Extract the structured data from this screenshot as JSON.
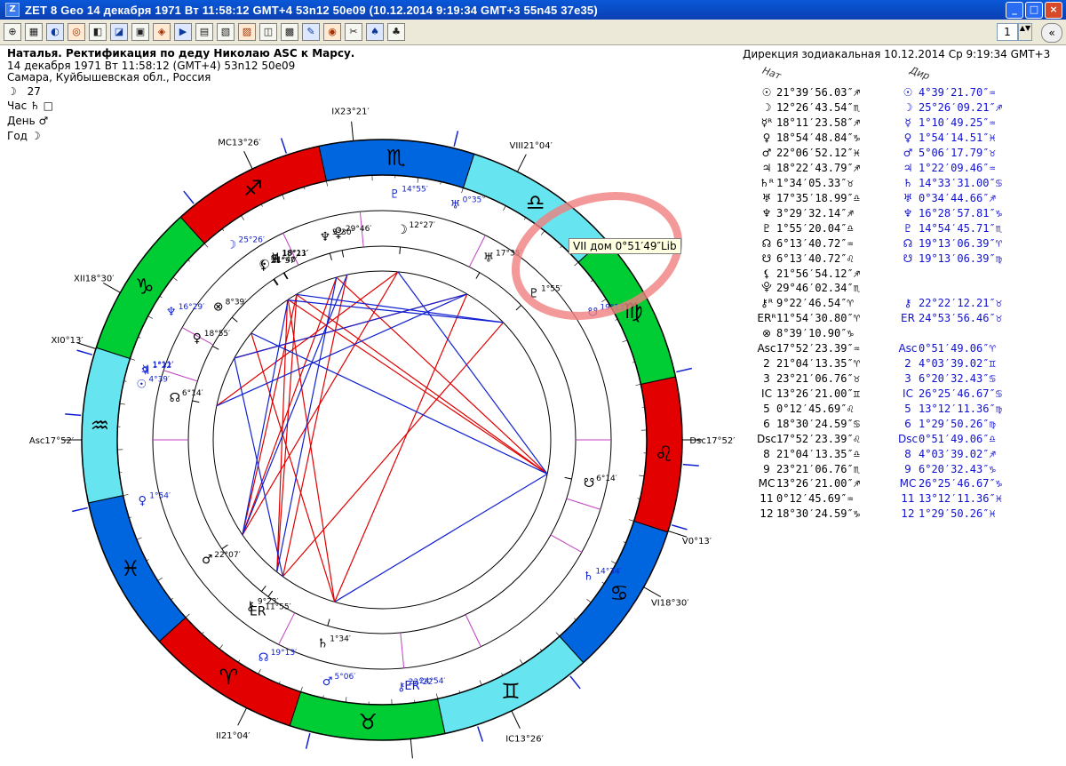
{
  "window": {
    "title": "ZET 8 Geo   14 декабря 1971  Вт  11:58:12 GMT+4 53n12  50e09  (10.12.2014   9:19:34 GMT+3 55n45 37e35)",
    "app_icon": "Z"
  },
  "window_buttons": {
    "minimize": "_",
    "maximize": "□",
    "close": "×"
  },
  "toolbar": {
    "icons": [
      "⊕",
      "▦",
      "◐",
      "◎",
      "◧",
      "◪",
      "▣",
      "◈",
      "▶",
      "▤",
      "▧",
      "▨",
      "◫",
      "▩",
      "✎",
      "◉",
      "✂",
      "♠",
      "♣"
    ],
    "spin_value": "1",
    "spin_arrows": "▲▼",
    "collapse": "«"
  },
  "header": {
    "line1": "Наталья. Ректификация по деду Николаю ASC к Марсу.",
    "line2": "14 декабря 1971  Вт  11:58:12 (GMT+4) 53n12  50e09",
    "line3": "Самара, Куйбышевская обл., Россия",
    "moon_day_symbol": "☽",
    "moon_day": "27",
    "hour_label": "Час",
    "hour_symbol": "♄",
    "hour_mark": "□",
    "day_label": "День",
    "day_symbol": "♂",
    "year_label": "Год",
    "year_symbol": "☽"
  },
  "direction": {
    "title": "Дирекция зодиакальная 10.12.2014  Ср  9:19:34 GMT+3",
    "col_natal": "Нат",
    "col_dir": "Дир"
  },
  "table": [
    {
      "s": "☉",
      "n": "21°39′56.03″♐",
      "s2": "☉",
      "d": "4°39′21.70″♒"
    },
    {
      "s": "☽",
      "n": "12°26′43.54″♏",
      "s2": "☽",
      "d": "25°26′09.21″♐"
    },
    {
      "s": "☿ᴿ",
      "n": "18°11′23.58″♐",
      "s2": "☿",
      "d": "1°10′49.25″♒"
    },
    {
      "s": "♀",
      "n": "18°54′48.84″♑",
      "s2": "♀",
      "d": "1°54′14.51″♓"
    },
    {
      "s": "♂",
      "n": "22°06′52.12″♓",
      "s2": "♂",
      "d": "5°06′17.79″♉"
    },
    {
      "s": "♃",
      "n": "18°22′43.79″♐",
      "s2": "♃",
      "d": "1°22′09.46″♒"
    },
    {
      "s": "♄ᴿ",
      "n": "1°34′05.33″♉",
      "s2": "♄",
      "d": "14°33′31.00″♋"
    },
    {
      "s": "♅",
      "n": "17°35′18.99″♎",
      "s2": "♅",
      "d": "0°34′44.66″♐"
    },
    {
      "s": "♆",
      "n": "3°29′32.14″♐",
      "s2": "♆",
      "d": "16°28′57.81″♑"
    },
    {
      "s": "♇",
      "n": "1°55′20.04″♎",
      "s2": "♇",
      "d": "14°54′45.71″♏"
    },
    {
      "s": "☊",
      "n": "6°13′40.72″♒",
      "s2": "☊",
      "d": "19°13′06.39″♈"
    },
    {
      "s": "☋",
      "n": "6°13′40.72″♌",
      "s2": "☋",
      "d": "19°13′06.39″♍"
    },
    {
      "s": "⚸",
      "n": "21°56′54.12″♐",
      "s2": "",
      "d": ""
    },
    {
      "s": "⯓",
      "n": "29°46′02.34″♏",
      "s2": "",
      "d": ""
    },
    {
      "s": "⚷ᴿ",
      "n": "9°22′46.54″♈",
      "s2": "⚷",
      "d": "22°22′12.21″♉"
    },
    {
      "s": "ERᴿ",
      "n": "11°54′30.80″♈",
      "s2": "ER",
      "d": "24°53′56.46″♉"
    },
    {
      "s": "⊗",
      "n": "8°39′10.90″♑",
      "s2": "",
      "d": ""
    },
    {
      "s": "Asc",
      "n": "17°52′23.39″♒",
      "s2": "Asc",
      "d": "0°51′49.06″♈"
    },
    {
      "s": "2",
      "n": "21°04′13.35″♈",
      "s2": "2",
      "d": "4°03′39.02″♊"
    },
    {
      "s": "3",
      "n": "23°21′06.76″♉",
      "s2": "3",
      "d": "6°20′32.43″♋"
    },
    {
      "s": "IC",
      "n": "13°26′21.00″♊",
      "s2": "IC",
      "d": "26°25′46.67″♋"
    },
    {
      "s": "5",
      "n": "0°12′45.69″♌",
      "s2": "5",
      "d": "13°12′11.36″♍"
    },
    {
      "s": "6",
      "n": "18°30′24.59″♋",
      "s2": "6",
      "d": "1°29′50.26″♍"
    },
    {
      "s": "Dsc",
      "n": "17°52′23.39″♌",
      "s2": "Dsc",
      "d": "0°51′49.06″♎"
    },
    {
      "s": "8",
      "n": "21°04′13.35″♎",
      "s2": "8",
      "d": "4°03′39.02″♐"
    },
    {
      "s": "9",
      "n": "23°21′06.76″♏",
      "s2": "9",
      "d": "6°20′32.43″♑"
    },
    {
      "s": "MC",
      "n": "13°26′21.00″♐",
      "s2": "MC",
      "d": "26°25′46.67″♑"
    },
    {
      "s": "11",
      "n": "0°12′45.69″♒",
      "s2": "11",
      "d": "13°12′11.36″♓"
    },
    {
      "s": "12",
      "n": "18°30′24.59″♑",
      "s2": "12",
      "d": "1°29′50.26″♓"
    }
  ],
  "tooltip": "VII дом  0°51′49″Lib",
  "colors": {
    "fire": "#e30000",
    "earth": "#00cc33",
    "air": "#66e5f0",
    "water": "#0066e0",
    "aspect_red": "#e00000",
    "aspect_blue": "#1020d0",
    "ring": "#000000",
    "marker_circle": "#f08080"
  },
  "wheel": {
    "signs": [
      "♈",
      "♉",
      "♊",
      "♋",
      "♌",
      "♍",
      "♎",
      "♏",
      "♐",
      "♑",
      "♒",
      "♓"
    ],
    "elements": [
      "fire",
      "earth",
      "air",
      "water",
      "fire",
      "earth",
      "air",
      "water",
      "fire",
      "earth",
      "air",
      "water"
    ],
    "house_labels": [
      {
        "t": "Asc17°52′",
        "k": "asc"
      },
      {
        "t": "XII18°30′",
        "k": "h12"
      },
      {
        "t": "XI0°13′",
        "k": "h11"
      },
      {
        "t": "MC13°26′",
        "k": "mc"
      },
      {
        "t": "IX23°21′",
        "k": "h9"
      },
      {
        "t": "VIII21°04′",
        "k": "h8"
      },
      {
        "t": "Dsc17°52′",
        "k": "dsc"
      },
      {
        "t": "VI18°30′",
        "k": "h6"
      },
      {
        "t": "V0°13′",
        "k": "h5"
      },
      {
        "t": "IC13°26′",
        "k": "ic"
      },
      {
        "t": "III23°21′",
        "k": "h3"
      },
      {
        "t": "II21°04′",
        "k": "h2"
      }
    ],
    "natal_planets": [
      {
        "g": "☉",
        "l": "21°40′",
        "k": "sun"
      },
      {
        "g": "☿",
        "l": "18°11′",
        "k": "mercury"
      },
      {
        "g": "♃",
        "l": "18°23′",
        "k": "jupiter"
      },
      {
        "g": "♆",
        "l": "3°30′",
        "k": "neptune"
      },
      {
        "g": "⯓",
        "l": "29°46′",
        "k": "proserpina"
      },
      {
        "g": "☽",
        "l": "12°27′",
        "k": "moon"
      },
      {
        "g": "⚸",
        "l": "21°57′",
        "k": "lilith"
      },
      {
        "g": "♅",
        "l": "17°35′",
        "k": "uranus"
      },
      {
        "g": "♇",
        "l": "1°55′",
        "k": "pluto"
      },
      {
        "g": "☋",
        "l": "6°14′",
        "k": "snode"
      },
      {
        "g": "♄",
        "l": "1°34′",
        "k": "saturn"
      },
      {
        "g": "ER",
        "l": "11°55′",
        "k": "eris"
      },
      {
        "g": "⚷",
        "l": "9°23′",
        "k": "chiron"
      },
      {
        "g": "♂",
        "l": "22°07′",
        "k": "mars"
      },
      {
        "g": "☊",
        "l": "6°14′",
        "k": "nnode"
      },
      {
        "g": "♀",
        "l": "18°55′",
        "k": "venus"
      },
      {
        "g": "⊗",
        "l": "8°39′",
        "k": "fortune"
      }
    ],
    "dir_planets": [
      {
        "g": "☽",
        "l": "25°26′",
        "k": "moon"
      },
      {
        "g": "♅",
        "l": "0°35′",
        "k": "uranus"
      },
      {
        "g": "♇",
        "l": "14°55′",
        "k": "pluto"
      },
      {
        "g": "☋",
        "l": "19°13′",
        "k": "snode"
      },
      {
        "g": "♄",
        "l": "14°34′",
        "k": "saturn"
      },
      {
        "g": "⚷",
        "l": "22°22′",
        "k": "chiron"
      },
      {
        "g": "ER",
        "l": "24°54′",
        "k": "eris"
      },
      {
        "g": "♂",
        "l": "5°06′",
        "k": "mars"
      },
      {
        "g": "☊",
        "l": "19°13′",
        "k": "nnode"
      },
      {
        "g": "♀",
        "l": "1°54′",
        "k": "venus"
      },
      {
        "g": "☉",
        "l": "4°39′",
        "k": "sun"
      },
      {
        "g": "☿",
        "l": "1°11′",
        "k": "mercury"
      },
      {
        "g": "♃",
        "l": "1°22′",
        "k": "jupiter"
      },
      {
        "g": "♆",
        "l": "16°29′",
        "k": "neptune"
      }
    ]
  }
}
